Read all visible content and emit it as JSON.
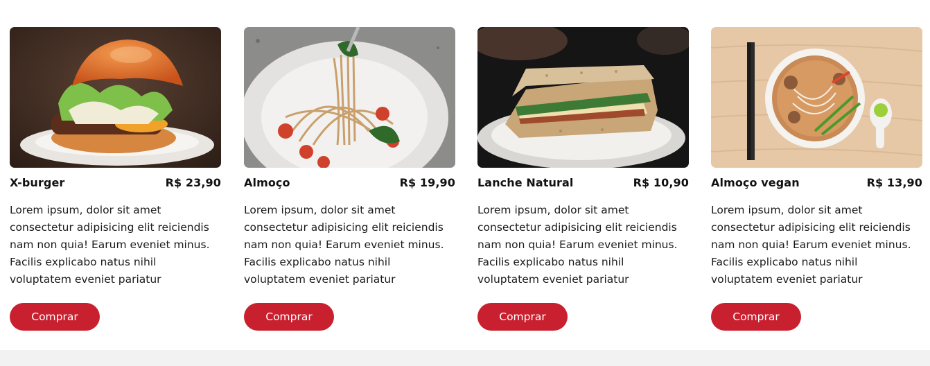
{
  "colors": {
    "accent": "#c9202f",
    "background": "#ffffff",
    "footer": "#f2f2f2"
  },
  "products": [
    {
      "name": "X-burger",
      "price": "R$ 23,90",
      "description": "Lorem ipsum, dolor sit amet consectetur adipisicing elit reiciendis nam non quia! Earum eveniet minus. Facilis explicabo natus nihil voluptatem eveniet pariatur",
      "button": "Comprar",
      "image": "burger-photo"
    },
    {
      "name": "Almoço",
      "price": "R$ 19,90",
      "description": "Lorem ipsum, dolor sit amet consectetur adipisicing elit reiciendis nam non quia! Earum eveniet minus. Facilis explicabo natus nihil voluptatem eveniet pariatur",
      "button": "Comprar",
      "image": "pasta-photo"
    },
    {
      "name": "Lanche Natural",
      "price": "R$ 10,90",
      "description": "Lorem ipsum, dolor sit amet consectetur adipisicing elit reiciendis nam non quia! Earum eveniet minus. Facilis explicabo natus nihil voluptatem eveniet pariatur",
      "button": "Comprar",
      "image": "sandwich-photo"
    },
    {
      "name": "Almoço vegan",
      "price": "R$ 13,90",
      "description": "Lorem ipsum, dolor sit amet consectetur adipisicing elit reiciendis nam non quia! Earum eveniet minus. Facilis explicabo natus nihil voluptatem eveniet pariatur",
      "button": "Comprar",
      "image": "noodle-soup-photo"
    }
  ]
}
